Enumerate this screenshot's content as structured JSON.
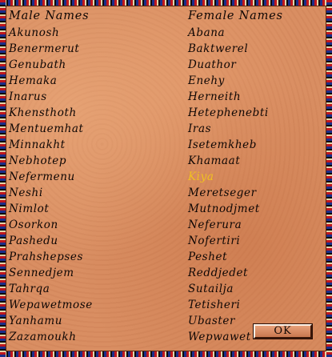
{
  "headers": {
    "male": "Male Names",
    "female": "Female Names"
  },
  "male_names": [
    "Akunosh",
    "Benermerut",
    "Genubath",
    "Hemaka",
    "Inarus",
    "Khensthoth",
    "Mentuemhat",
    "Minnakht",
    "Nebhotep",
    "Nefermenu",
    "Neshi",
    "Nimlot",
    "Osorkon",
    "Pashedu",
    "Prahshepses",
    "Sennedjem",
    "Tahrqa",
    "Wepawetmose",
    "Yanhamu",
    "Zazamoukh"
  ],
  "female_names": [
    "Abana",
    "Baktwerel",
    "Duathor",
    "Enehy",
    "Herneith",
    "Hetephenebti",
    "Iras",
    "Isetemkheb",
    "Khamaat",
    "Kiya",
    "Meretseger",
    "Mutnodjmet",
    "Neferura",
    "Nofertiri",
    "Peshet",
    "Reddjedet",
    "Sutailja",
    "Tetisheri",
    "Ubaster",
    "Wepwawet"
  ],
  "selected_female_index": 9,
  "ok_button": {
    "label": "OK"
  },
  "colors": {
    "parchment": "#d98e62",
    "text": "#0e0604",
    "highlight": "#f0c020"
  }
}
